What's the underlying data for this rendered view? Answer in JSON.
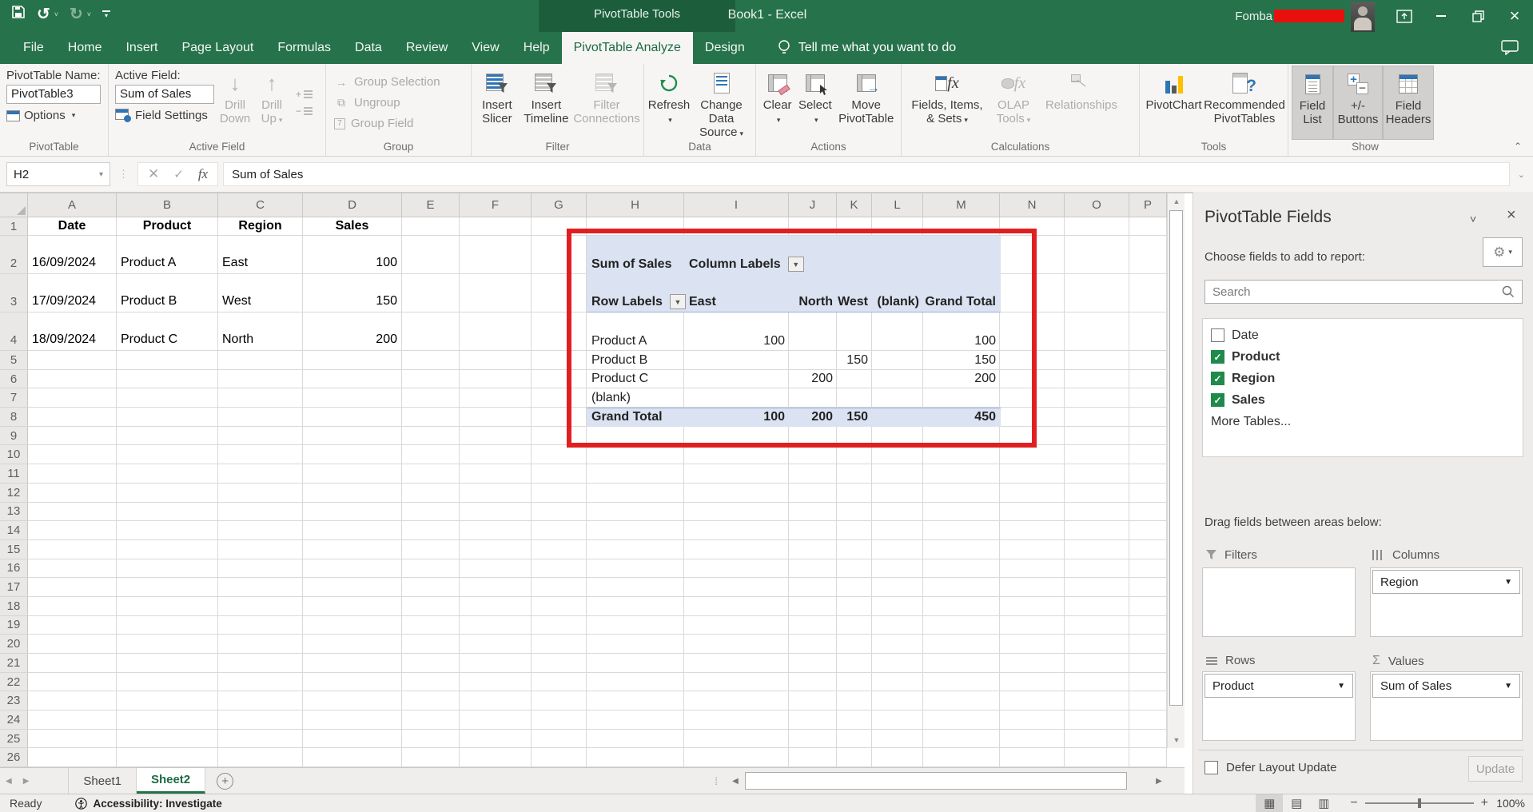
{
  "title_bar": {
    "context_label": "PivotTable Tools",
    "doc_title": "Book1 - Excel",
    "user_name": "Fomba"
  },
  "ribbon_tabs": [
    {
      "label": "File",
      "active": false
    },
    {
      "label": "Home",
      "active": false
    },
    {
      "label": "Insert",
      "active": false
    },
    {
      "label": "Page Layout",
      "active": false
    },
    {
      "label": "Formulas",
      "active": false
    },
    {
      "label": "Data",
      "active": false
    },
    {
      "label": "Review",
      "active": false
    },
    {
      "label": "View",
      "active": false
    },
    {
      "label": "Help",
      "active": false
    },
    {
      "label": "PivotTable Analyze",
      "active": true
    },
    {
      "label": "Design",
      "active": false
    }
  ],
  "tell_me": "Tell me what you want to do",
  "ribbon": {
    "pivottable": {
      "name_label": "PivotTable Name:",
      "name_value": "PivotTable3",
      "options_label": "Options",
      "group_label": "PivotTable"
    },
    "active_field": {
      "label": "Active Field:",
      "value": "Sum of Sales",
      "field_settings_label": "Field Settings",
      "drill_down_label": "Drill Down",
      "drill_up_label": "Drill Up",
      "group_label": "Active Field"
    },
    "group": {
      "selection_label": "Group Selection",
      "ungroup_label": "Ungroup",
      "field_label": "Group Field",
      "group_label": "Group"
    },
    "filter": {
      "slicer_label": "Insert Slicer",
      "timeline_label": "Insert Timeline",
      "connections_label": "Filter Connections",
      "group_label": "Filter"
    },
    "data": {
      "refresh_label": "Refresh",
      "change_source_label": "Change Data Source",
      "group_label": "Data"
    },
    "actions": {
      "clear_label": "Clear",
      "select_label": "Select",
      "move_label": "Move PivotTable",
      "group_label": "Actions"
    },
    "calculations": {
      "fields_label": "Fields, Items, & Sets",
      "olap_label": "OLAP Tools",
      "relationships_label": "Relationships",
      "group_label": "Calculations"
    },
    "tools": {
      "pivotchart_label": "PivotChart",
      "recommended_label": "Recommended PivotTables",
      "group_label": "Tools"
    },
    "show": {
      "field_list_label": "Field List",
      "buttons_label": "+/- Buttons",
      "headers_label": "Field Headers",
      "group_label": "Show"
    }
  },
  "formula_bar": {
    "name_box": "H2",
    "formula": "Sum of Sales"
  },
  "sheet": {
    "columns": [
      "A",
      "B",
      "C",
      "D",
      "E",
      "F",
      "G",
      "H",
      "I",
      "J",
      "K",
      "L",
      "M",
      "N",
      "O",
      "P"
    ],
    "row_count": 26,
    "header_row": [
      "Date",
      "Product",
      "Region",
      "Sales"
    ],
    "records": [
      [
        "16/09/2024",
        "Product A",
        "East",
        "100"
      ],
      [
        "17/09/2024",
        "Product B",
        "West",
        "150"
      ],
      [
        "18/09/2024",
        "Product C",
        "North",
        "200"
      ]
    ]
  },
  "pivot": {
    "measure_label": "Sum of Sales",
    "column_labels_label": "Column Labels",
    "row_labels_label": "Row Labels",
    "columns": [
      "East",
      "North",
      "West",
      "(blank)",
      "Grand Total"
    ],
    "rows": [
      {
        "label": "Product A",
        "values": [
          "100",
          "",
          "",
          "",
          "100"
        ],
        "is_total": false
      },
      {
        "label": "Product B",
        "values": [
          "",
          "",
          "150",
          "",
          "150"
        ],
        "is_total": false
      },
      {
        "label": "Product C",
        "values": [
          "",
          "200",
          "",
          "",
          "200"
        ],
        "is_total": false
      },
      {
        "label": "(blank)",
        "values": [
          "",
          "",
          "",
          "",
          ""
        ],
        "is_total": false
      },
      {
        "label": "Grand Total",
        "values": [
          "100",
          "200",
          "150",
          "",
          "450"
        ],
        "is_total": true
      }
    ]
  },
  "fields_pane": {
    "title": "PivotTable Fields",
    "choose_label": "Choose fields to add to report:",
    "search_placeholder": "Search",
    "fields": [
      {
        "name": "Date",
        "checked": false
      },
      {
        "name": "Product",
        "checked": true
      },
      {
        "name": "Region",
        "checked": true
      },
      {
        "name": "Sales",
        "checked": true
      }
    ],
    "more_tables": "More Tables...",
    "drag_label": "Drag fields between areas below:",
    "areas": {
      "filters": {
        "label": "Filters",
        "items": []
      },
      "columns": {
        "label": "Columns",
        "items": [
          "Region"
        ]
      },
      "rows": {
        "label": "Rows",
        "items": [
          "Product"
        ]
      },
      "values": {
        "label": "Values",
        "items": [
          "Sum of Sales"
        ]
      }
    },
    "defer_label": "Defer Layout Update",
    "update_label": "Update"
  },
  "sheet_tabs": {
    "tabs": [
      {
        "label": "Sheet1",
        "active": false
      },
      {
        "label": "Sheet2",
        "active": true
      }
    ]
  },
  "status_bar": {
    "mode": "Ready",
    "accessibility": "Accessibility: Investigate",
    "zoom_level": "100%"
  },
  "colors": {
    "excel_green": "#217346",
    "context_green": "#1C5E3C",
    "pivot_band": "#DBE2F1",
    "annotation_red": "#E02020",
    "checkbox_green": "#1F8A4C"
  }
}
